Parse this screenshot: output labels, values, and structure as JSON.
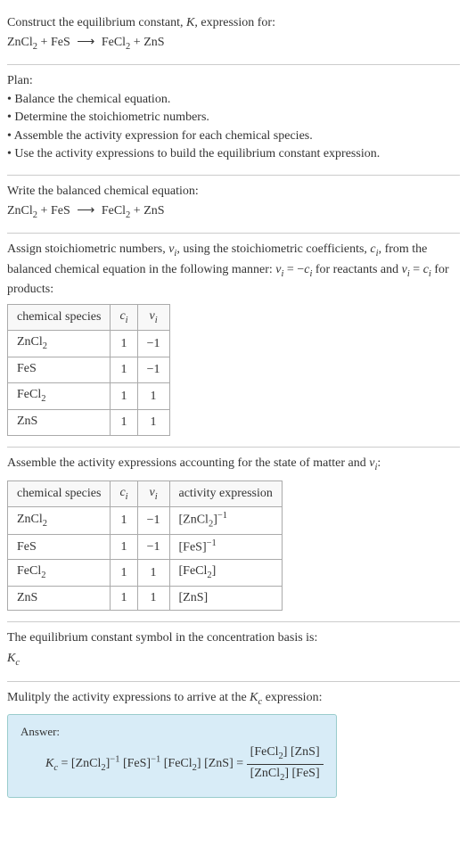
{
  "chart_data": [
    {
      "type": "table",
      "title": "Stoichiometric coefficients and numbers",
      "columns": [
        "chemical species",
        "c_i",
        "ν_i"
      ],
      "rows": [
        {
          "species": "ZnCl2",
          "c_i": 1,
          "nu_i": -1
        },
        {
          "species": "FeS",
          "c_i": 1,
          "nu_i": -1
        },
        {
          "species": "FeCl2",
          "c_i": 1,
          "nu_i": 1
        },
        {
          "species": "ZnS",
          "c_i": 1,
          "nu_i": 1
        }
      ]
    },
    {
      "type": "table",
      "title": "Activity expressions by species",
      "columns": [
        "chemical species",
        "c_i",
        "ν_i",
        "activity expression"
      ],
      "rows": [
        {
          "species": "ZnCl2",
          "c_i": 1,
          "nu_i": -1,
          "activity": "[ZnCl2]^-1"
        },
        {
          "species": "FeS",
          "c_i": 1,
          "nu_i": -1,
          "activity": "[FeS]^-1"
        },
        {
          "species": "FeCl2",
          "c_i": 1,
          "nu_i": 1,
          "activity": "[FeCl2]"
        },
        {
          "species": "ZnS",
          "c_i": 1,
          "nu_i": 1,
          "activity": "[ZnS]"
        }
      ]
    }
  ],
  "header": {
    "prompt_line": "Construct the equilibrium constant, ",
    "K": "K",
    "prompt_suffix": ", expression for:",
    "eq_lhs_a": "ZnCl",
    "eq_lhs_b": "FeS",
    "eq_rhs_a": "FeCl",
    "eq_rhs_b": "ZnS",
    "sub2": "2",
    "plus": " + ",
    "arrow": "⟶"
  },
  "plan": {
    "title": "Plan:",
    "items": [
      "• Balance the chemical equation.",
      "• Determine the stoichiometric numbers.",
      "• Assemble the activity expression for each chemical species.",
      "• Use the activity expressions to build the equilibrium constant expression."
    ]
  },
  "balanced": {
    "title": "Write the balanced chemical equation:"
  },
  "stoich": {
    "intro_a": "Assign stoichiometric numbers, ",
    "nu": "ν",
    "sub_i": "i",
    "intro_b": ", using the stoichiometric coefficients, ",
    "c": "c",
    "intro_c": ", from the balanced chemical equation in the following manner: ",
    "rel1_a": " = −",
    "rel1_b": " for reactants and ",
    "rel2_a": " = ",
    "rel2_b": " for products:",
    "col_species": "chemical species",
    "col_ci": "c",
    "col_nu": "ν",
    "rows": [
      {
        "s": "ZnCl",
        "sub": "2",
        "c": "1",
        "n": "−1"
      },
      {
        "s": "FeS",
        "sub": "",
        "c": "1",
        "n": "−1"
      },
      {
        "s": "FeCl",
        "sub": "2",
        "c": "1",
        "n": "1"
      },
      {
        "s": "ZnS",
        "sub": "",
        "c": "1",
        "n": "1"
      }
    ]
  },
  "activity": {
    "title_a": "Assemble the activity expressions accounting for the state of matter and ",
    "title_b": ":",
    "col_species": "chemical species",
    "col_ci": "c",
    "col_nu": "ν",
    "col_act": "activity expression",
    "sub_i": "i",
    "rows": [
      {
        "s": "ZnCl",
        "sub": "2",
        "c": "1",
        "n": "−1",
        "act_base": "[ZnCl",
        "act_sub": "2",
        "act_close": "]",
        "act_exp": "−1"
      },
      {
        "s": "FeS",
        "sub": "",
        "c": "1",
        "n": "−1",
        "act_base": "[FeS",
        "act_sub": "",
        "act_close": "]",
        "act_exp": "−1"
      },
      {
        "s": "FeCl",
        "sub": "2",
        "c": "1",
        "n": "1",
        "act_base": "[FeCl",
        "act_sub": "2",
        "act_close": "]",
        "act_exp": ""
      },
      {
        "s": "ZnS",
        "sub": "",
        "c": "1",
        "n": "1",
        "act_base": "[ZnS",
        "act_sub": "",
        "act_close": "]",
        "act_exp": ""
      }
    ]
  },
  "symbol": {
    "line": "The equilibrium constant symbol in the concentration basis is:",
    "K": "K",
    "sub_c": "c"
  },
  "multiply": {
    "line_a": "Mulitply the activity expressions to arrive at the ",
    "K": "K",
    "sub_c": "c",
    "line_b": " expression:"
  },
  "answer": {
    "label": "Answer:",
    "K": "K",
    "sub_c": "c",
    "eq": " = ",
    "t1": "[ZnCl",
    "t1s": "2",
    "t1c": "]",
    "t2": "[FeS]",
    "t2exp": "−1",
    "t3": "[FeCl",
    "t3s": "2",
    "t3c": "] ",
    "t4": "[ZnS]",
    "exp_neg1": "−1",
    "eq2": " = ",
    "num_a": "[FeCl",
    "num_as": "2",
    "num_ac": "] [ZnS]",
    "den_a": "[ZnCl",
    "den_as": "2",
    "den_ac": "] [FeS]"
  }
}
